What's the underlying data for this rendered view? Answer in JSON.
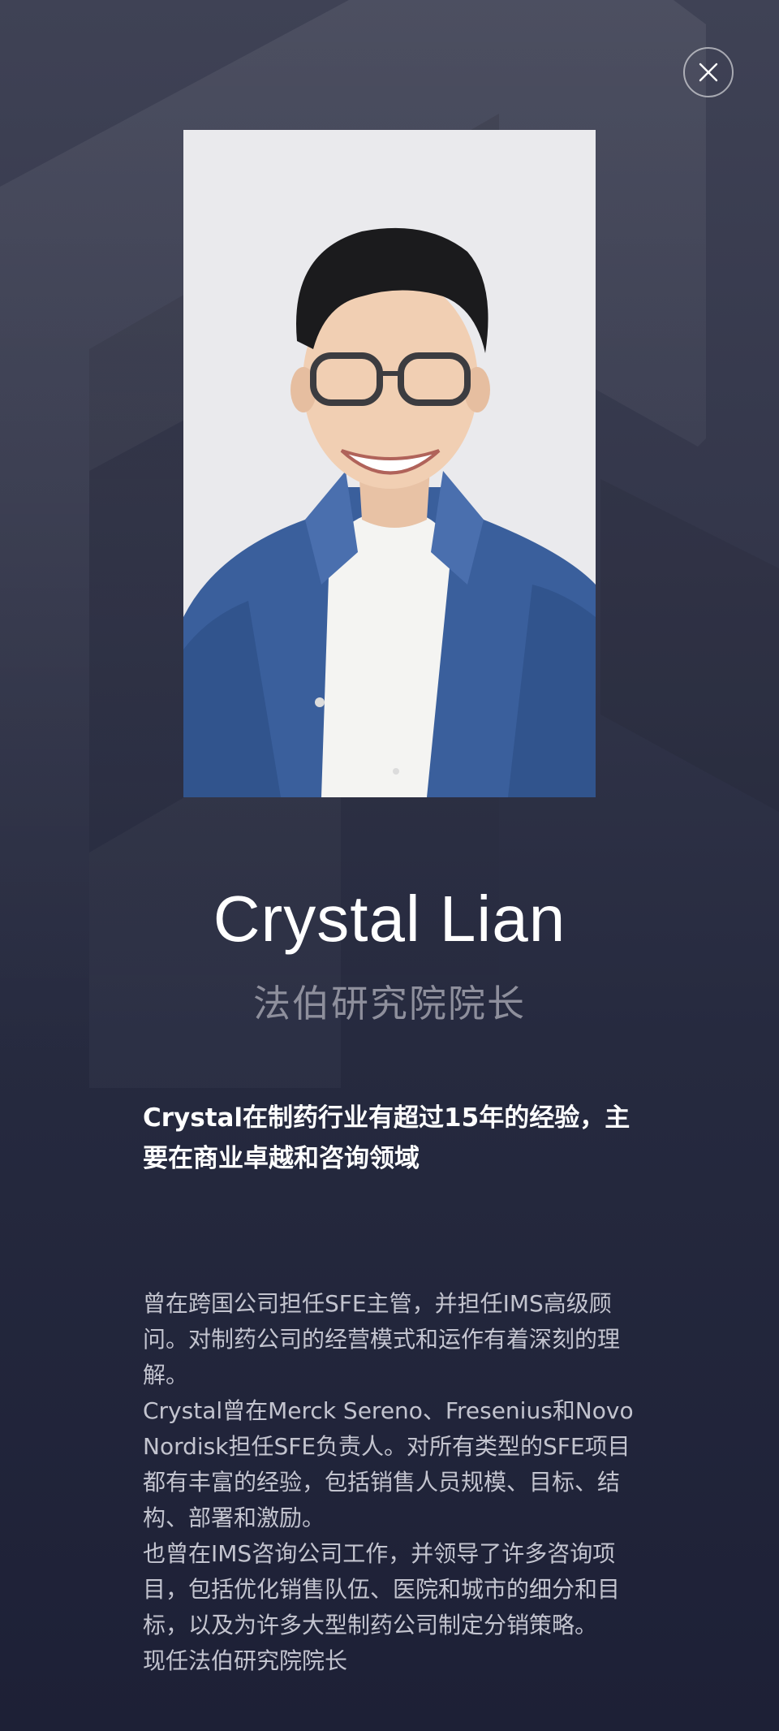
{
  "profile": {
    "name": "Crystal Lian",
    "title": "法伯研究院院长",
    "headline": "Crystal在制药行业有超过15年的经验，主要在商业卓越和咨询领域",
    "bio": [
      "曾在跨国公司担任SFE主管，并担任IMS高级顾问。对制药公司的经营模式和运作有着深刻的理解。",
      "Crystal曾在Merck Sereno、Fresenius和Novo Nordisk担任SFE负责人。对所有类型的SFE项目都有丰富的经验，包括销售人员规模、目标、结构、部署和激励。",
      "也曾在IMS咨询公司工作，并领导了许多咨询项目，包括优化销售队伍、医院和城市的细分和目标，以及为许多大型制药公司制定分销策略。",
      "现任法伯研究院院长"
    ]
  },
  "icons": {
    "close": "close-icon",
    "photo": "portrait-photo"
  },
  "colors": {
    "background_top": "#3f4255",
    "background_bottom": "#1d2036",
    "title_gray": "#8e8f9c",
    "bio_gray": "#c3c4cf",
    "shirt_blue": "#3a5f9c"
  }
}
